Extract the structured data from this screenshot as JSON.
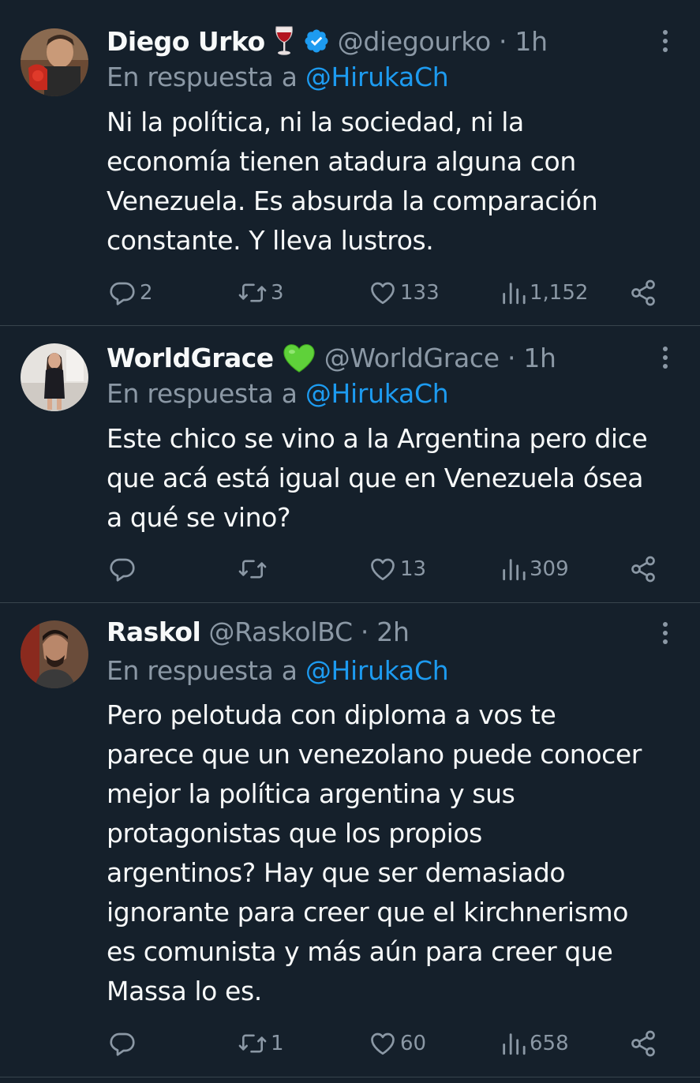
{
  "colors": {
    "background": "#15202b",
    "text": "#f7f9f9",
    "secondary": "#8b98a5",
    "accent": "#1d9bf0",
    "divider": "#38444d"
  },
  "tweets": [
    {
      "name": "Diego Urko",
      "badges": [
        "wine-glass-emoji",
        "verified-badge-icon"
      ],
      "handle_time": "@diegourko · 1h",
      "reply_prefix": "En respuesta a",
      "reply_to": "@HirukaCh",
      "lines": [
        "Ni la política, ni la sociedad, ni la",
        "economía tienen atadura alguna con",
        "Venezuela. Es absurda la comparación",
        "constante. Y lleva lustros."
      ],
      "stats": {
        "replies": "2",
        "retweets": "3",
        "likes": "133",
        "views": "1,152"
      }
    },
    {
      "name": "WorldGrace",
      "badges": [
        "green-heart-emoji"
      ],
      "handle_time": "@WorldGrace · 1h",
      "reply_prefix": "En respuesta a",
      "reply_to": "@HirukaCh",
      "lines": [
        "Este chico se vino a la Argentina pero dice",
        "que acá está igual que en Venezuela ósea",
        "a qué se vino?"
      ],
      "stats": {
        "replies": "",
        "retweets": "",
        "likes": "13",
        "views": "309"
      }
    },
    {
      "name": "Raskol",
      "badges": [],
      "handle_time": "@RaskolBC · 2h",
      "reply_prefix": "En respuesta a",
      "reply_to": "@HirukaCh",
      "lines": [
        "Pero pelotuda con diploma a vos te",
        "parece que un venezolano puede conocer",
        "mejor la política argentina y sus",
        "protagonistas que los propios",
        "argentinos? Hay que ser demasiado",
        "ignorante para creer que el kirchnerismo",
        "es comunista y más aún para creer que",
        "Massa lo es."
      ],
      "stats": {
        "replies": "",
        "retweets": "1",
        "likes": "60",
        "views": "658"
      }
    }
  ]
}
